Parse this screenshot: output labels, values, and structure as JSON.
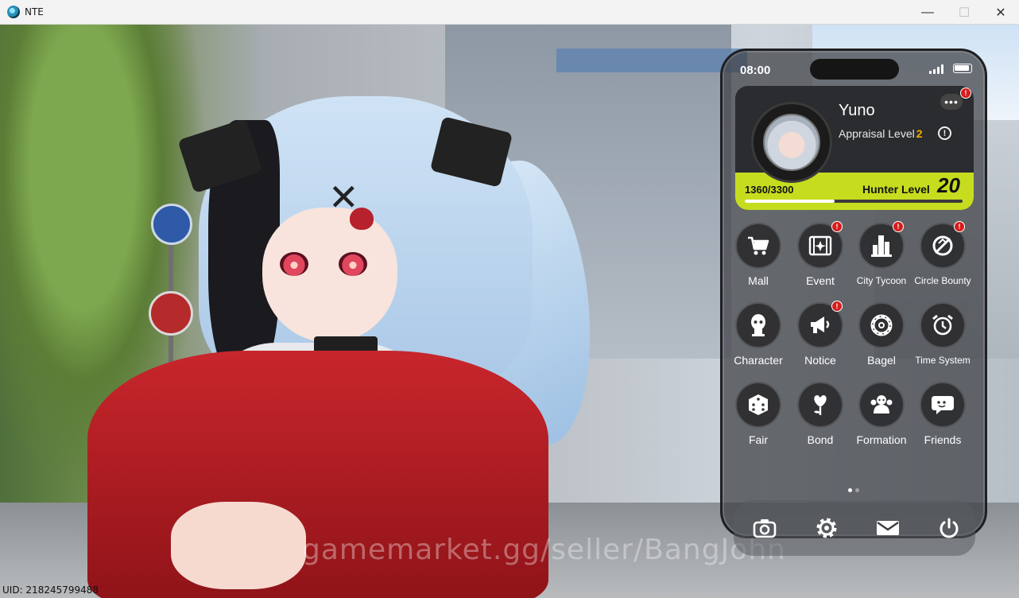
{
  "window": {
    "title": "NTE",
    "minimize": "—",
    "maximize": "☐",
    "close": "✕"
  },
  "uid_text": "UID: 218245799488",
  "watermark": "gamemarket.gg/seller/BangJohn",
  "phone": {
    "time": "08:00",
    "profile": {
      "name": "Yuno",
      "appraisal_label": "Appraisal Level",
      "appraisal_level": "2",
      "more": "•••",
      "exp_text": "1360/3300",
      "exp_fraction": 0.412,
      "hunter_level_label": "Hunter Level",
      "hunter_level": "20",
      "info": "!"
    },
    "apps": [
      {
        "label": "Mall",
        "icon": "cart-icon",
        "badge": false
      },
      {
        "label": "Event",
        "icon": "film-star-icon",
        "badge": true
      },
      {
        "label": "City Tycoon",
        "icon": "buildings-icon",
        "badge": true
      },
      {
        "label": "Circle Bounty",
        "icon": "circle-slash-icon",
        "badge": true
      },
      {
        "label": "Character",
        "icon": "ghost-head-icon",
        "badge": false
      },
      {
        "label": "Notice",
        "icon": "megaphone-icon",
        "badge": true
      },
      {
        "label": "Bagel",
        "icon": "bagel-icon",
        "badge": false
      },
      {
        "label": "Time System",
        "icon": "alarm-clock-icon",
        "badge": false
      },
      {
        "label": "Fair",
        "icon": "dice-icon",
        "badge": false
      },
      {
        "label": "Bond",
        "icon": "heart-flower-icon",
        "badge": false
      },
      {
        "label": "Formation",
        "icon": "group-icon",
        "badge": false
      },
      {
        "label": "Friends",
        "icon": "chat-bubble-icon",
        "badge": false
      }
    ],
    "page_dots": {
      "count": 2,
      "active": 0
    },
    "dock": [
      {
        "icon": "camera-icon"
      },
      {
        "icon": "gear-icon"
      },
      {
        "icon": "mail-icon"
      },
      {
        "icon": "power-icon"
      }
    ],
    "badge_text": "!",
    "colors": {
      "level_bar": "#c6dd1f",
      "appraisal_number": "#f0b100",
      "badge": "#d61c1c"
    }
  }
}
